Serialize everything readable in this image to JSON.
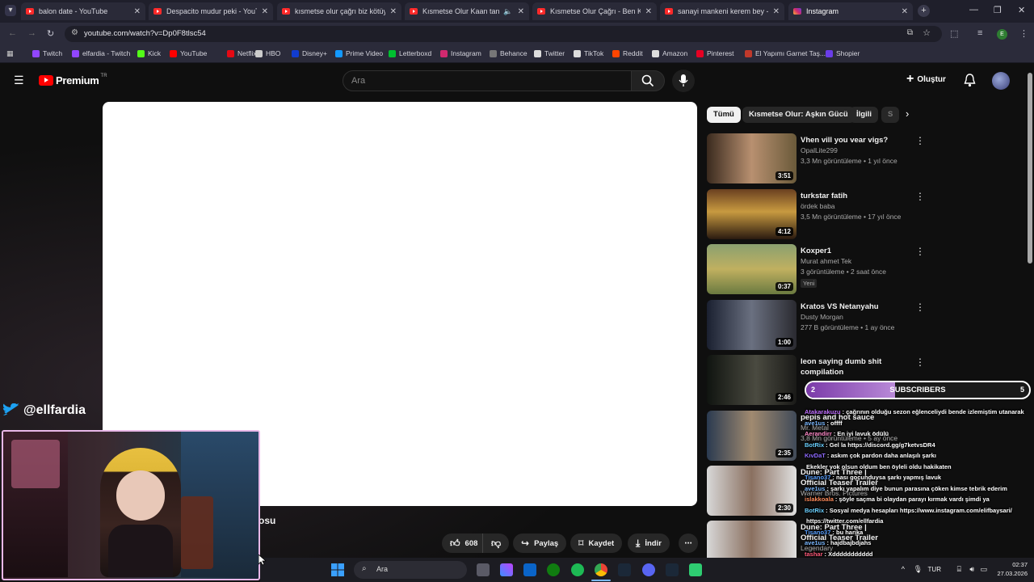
{
  "browser": {
    "tabs": [
      {
        "title": "balon date - YouTube",
        "icon": "youtube-icon"
      },
      {
        "title": "Despacito mudur peki - YouTube",
        "icon": "youtube-icon"
      },
      {
        "title": "kısmetse olur çağrı biz kötüyüz",
        "icon": "youtube-icon"
      },
      {
        "title": "Kısmetse Olur Kaan tanıtım",
        "icon": "youtube-icon"
      },
      {
        "title": "Kısmetse Olur Çağrı - Ben Kötü",
        "icon": "youtube-icon"
      },
      {
        "title": "sanayi mankeni kerem bey - Yo",
        "icon": "youtube-icon"
      },
      {
        "title": "Instagram",
        "icon": "instagram-icon"
      }
    ],
    "url": "youtube.com/watch?v=Dp0F8tlsc54",
    "profile_initial": "E",
    "bookmarks": [
      {
        "label": "Twitch",
        "color": "#9146ff"
      },
      {
        "label": "elfardia - Twitch",
        "color": "#9146ff"
      },
      {
        "label": "Kick",
        "color": "#53fc18"
      },
      {
        "label": "YouTube",
        "color": "#ff0000"
      },
      {
        "label": "Netflix",
        "color": "#e50914"
      },
      {
        "label": "HBO",
        "color": "#cccccc"
      },
      {
        "label": "Disney+",
        "color": "#113ccf"
      },
      {
        "label": "Prime Video",
        "color": "#1399ff"
      },
      {
        "label": "Letterboxd",
        "color": "#00c030"
      },
      {
        "label": "Instagram",
        "color": "#d1296f"
      },
      {
        "label": "Behance",
        "color": "#777777"
      },
      {
        "label": "Twitter",
        "color": "#dddddd"
      },
      {
        "label": "TikTok",
        "color": "#dddddd"
      },
      {
        "label": "Reddit",
        "color": "#ff4500"
      },
      {
        "label": "Amazon",
        "color": "#dddddd"
      },
      {
        "label": "Pinterest",
        "color": "#e60023"
      },
      {
        "label": "El Yapımı Garnet Taş...",
        "color": "#c0392b"
      },
      {
        "label": "Shopier",
        "color": "#6a3de8"
      }
    ]
  },
  "youtube": {
    "logo_text": "Premium",
    "logo_sup": "TR",
    "search_placeholder": "Ara",
    "create_label": "Oluştur",
    "chips": [
      "Tümü",
      "Kısmetse Olur: Aşkın Gücü",
      "İlgili",
      "S"
    ],
    "video_title_fragment": "osu",
    "actions": {
      "like_count": "608",
      "share": "Paylaş",
      "save": "Kaydet",
      "download": "İndir"
    },
    "recommendations": [
      {
        "title": "Vhen vill you vear vigs?",
        "channel": "OpalLite299",
        "meta": "3,3 Mn görüntüleme • 1 yıl önce",
        "duration": "3:51",
        "badge": ""
      },
      {
        "title": "turkstar fatih",
        "channel": "ördek baba",
        "meta": "3,5 Mn görüntüleme • 17 yıl önce",
        "duration": "4:12",
        "badge": ""
      },
      {
        "title": "Koxper1",
        "channel": "Murat ahmet Tek",
        "meta": "3 görüntüleme • 2 saat önce",
        "duration": "0:37",
        "badge": "Yeni"
      },
      {
        "title": "Kratos VS Netanyahu",
        "channel": "Dusty Morgan",
        "meta": "277 B görüntüleme • 1 ay önce",
        "duration": "1:00",
        "badge": ""
      },
      {
        "title": "leon saying dumb shit compilation",
        "channel": "",
        "meta": "",
        "duration": "2:46",
        "badge": ""
      },
      {
        "title": "pepis and hot sauce",
        "channel": "Mr. Metal",
        "meta": "3,8 Mn görüntüleme • 5 ay önce",
        "duration": "2:35",
        "badge": ""
      },
      {
        "title": "Dune: Part Three | Official Teaser Trailer",
        "channel": "Warner Bros. Pictures",
        "meta": "",
        "duration": "2:30",
        "badge": ""
      },
      {
        "title": "Dune: Part Three | Official Teaser Trailer",
        "channel": "Legendary",
        "meta": "",
        "duration": "",
        "badge": ""
      }
    ]
  },
  "stream": {
    "twitter_handle": "@ellfardia",
    "subs": {
      "label": "SUBSCRIBERS",
      "current": "2",
      "goal": "5",
      "progress": 0.4
    },
    "chat": [
      {
        "user": "Atakarakuzu",
        "color": "#c070ff",
        "text": "çağrının olduğu sezon eğlenceliydi bende izlemiştim utanarak"
      },
      {
        "user": "ave1us",
        "color": "#7ab8ff",
        "text": "offff"
      },
      {
        "user": "Aerandirr",
        "color": "#ff8ac8",
        "text": "En iyi lavuk ödülü"
      },
      {
        "user": "BotRix",
        "color": "#6ad0ff",
        "text": "Gel la https://discord.gg/g7ketvsDR4"
      },
      {
        "user": "KıvDaT",
        "color": "#8e6aff",
        "text": "askım çok pardon daha anlaşılı şarkı"
      },
      {
        "user": "",
        "color": "#ffffff",
        "text": "Ekekler yok olsun oldum ben öyleli oldu hakikaten"
      },
      {
        "user": "Tisano37",
        "color": "#5aa0ff",
        "text": "nası gocunduysa şarkı yapmış lavuk"
      },
      {
        "user": "ave1us",
        "color": "#7ab8ff",
        "text": "şarkı yapalım diye bunun parasına çöken kimse tebrik ederim"
      },
      {
        "user": "islakkoala",
        "color": "#ff8a5a",
        "text": "şöyle saçma bi olaydan parayı kırmak vardı şimdi ya"
      },
      {
        "user": "BotRix",
        "color": "#6ad0ff",
        "text": "Sosyal medya hesapları https://www.instagram.com/elifbaysari/"
      },
      {
        "user": "",
        "color": "#ffffff",
        "text": "https://twitter.com/ellfardia"
      },
      {
        "user": "Tisano37",
        "color": "#5aa0ff",
        "text": "bu harika"
      },
      {
        "user": "ave1us",
        "color": "#7ab8ff",
        "text": "hajdbajbdjahs"
      },
      {
        "user": "tashar",
        "color": "#ff5a7a",
        "text": "Xddddddddddd"
      }
    ]
  },
  "taskbar": {
    "search_placeholder": "Ara",
    "lang": "TUR",
    "time": "02:37",
    "date": "27.03.2026"
  }
}
